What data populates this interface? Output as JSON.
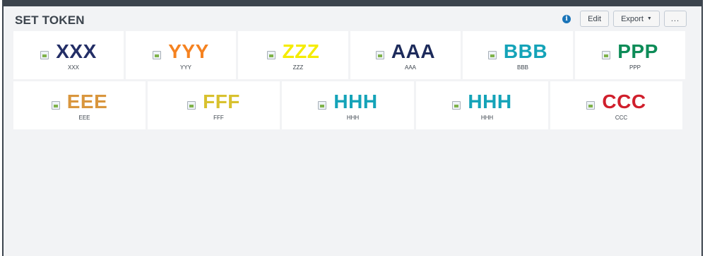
{
  "header": {
    "title": "SET TOKEN",
    "info_icon": "i",
    "edit_label": "Edit",
    "export_label": "Export",
    "export_caret": "▼",
    "more_label": "..."
  },
  "tiles_row1": [
    {
      "value": "XXX",
      "label": "XXX",
      "color": "#232e66"
    },
    {
      "value": "YYY",
      "label": "YYY",
      "color": "#f58220"
    },
    {
      "value": "ZZZ",
      "label": "ZZZ",
      "color": "#f5ec00"
    },
    {
      "value": "AAA",
      "label": "AAA",
      "color": "#1d2b5b"
    },
    {
      "value": "BBB",
      "label": "BBB",
      "color": "#14a3b8"
    },
    {
      "value": "PPP",
      "label": "PPP",
      "color": "#0d8c58"
    }
  ],
  "tiles_row2": [
    {
      "value": "EEE",
      "label": "EEE",
      "color": "#d9963d"
    },
    {
      "value": "FFF",
      "label": "FFF",
      "color": "#d8c12e"
    },
    {
      "value": "HHH",
      "label": "HHH",
      "color": "#14a3b8"
    },
    {
      "value": "HHH",
      "label": "HHH",
      "color": "#14a3b8"
    },
    {
      "value": "CCC",
      "label": "CCC",
      "color": "#d01f2c"
    }
  ]
}
